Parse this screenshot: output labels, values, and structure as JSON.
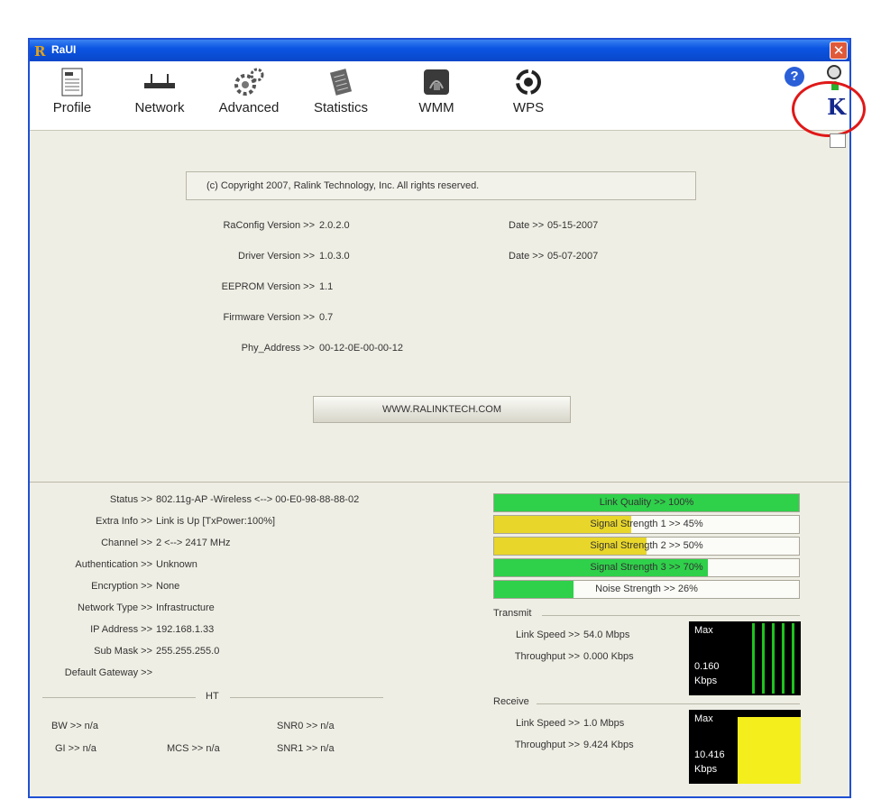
{
  "window": {
    "title": "RaUI",
    "close_glyph": "✕"
  },
  "toolbar": [
    {
      "label": "Profile",
      "icon": "profile-icon"
    },
    {
      "label": "Network",
      "icon": "network-icon"
    },
    {
      "label": "Advanced",
      "icon": "advanced-icon"
    },
    {
      "label": "Statistics",
      "icon": "statistics-icon"
    },
    {
      "label": "WMM",
      "icon": "wmm-icon"
    },
    {
      "label": "WPS",
      "icon": "wps-icon"
    }
  ],
  "about": {
    "copyright": "(c) Copyright 2007, Ralink Technology, Inc.  All rights reserved.",
    "raconfig_label": "RaConfig Version >>",
    "raconfig_value": "2.0.2.0",
    "raconfig_date_label": "Date >>",
    "raconfig_date": "05-15-2007",
    "driver_label": "Driver Version >>",
    "driver_value": "1.0.3.0",
    "driver_date_label": "Date >>",
    "driver_date": "05-07-2007",
    "eeprom_label": "EEPROM Version >>",
    "eeprom_value": "1.1",
    "firmware_label": "Firmware Version >>",
    "firmware_value": "0.7",
    "phy_label": "Phy_Address >>",
    "phy_value": "00-12-0E-00-00-12",
    "website_button": "WWW.RALINKTECH.COM"
  },
  "status": {
    "rows": [
      {
        "label": "Status >>",
        "value": "802.11g-AP -Wireless  <--> 00-E0-98-88-88-02"
      },
      {
        "label": "Extra Info >>",
        "value": "Link is Up [TxPower:100%]"
      },
      {
        "label": "Channel >>",
        "value": "2 <--> 2417 MHz"
      },
      {
        "label": "Authentication >>",
        "value": "Unknown"
      },
      {
        "label": "Encryption >>",
        "value": "None"
      },
      {
        "label": "Network Type >>",
        "value": "Infrastructure"
      },
      {
        "label": "IP Address >>",
        "value": "192.168.1.33"
      },
      {
        "label": "Sub Mask >>",
        "value": "255.255.255.0"
      },
      {
        "label": "Default Gateway >>",
        "value": ""
      }
    ],
    "ht": {
      "title": "HT",
      "bw": "BW >> n/a",
      "gi": "GI >> n/a",
      "mcs": "MCS >> n/a",
      "snr0": "SNR0 >> n/a",
      "snr1": "SNR1 >> n/a"
    }
  },
  "signal_bars": [
    {
      "label": "Link Quality >> 100%",
      "level": 1.0,
      "color": "#2fd04a"
    },
    {
      "label": "Signal Strength 1 >> 45%",
      "level": 0.45,
      "color": "#e8d62a"
    },
    {
      "label": "Signal Strength 2 >> 50%",
      "level": 0.5,
      "color": "#e8d62a"
    },
    {
      "label": "Signal Strength 3 >> 70%",
      "level": 0.7,
      "color": "#2fd04a"
    },
    {
      "label": "Noise Strength >> 26%",
      "level": 0.26,
      "color": "#2fd04a"
    }
  ],
  "transmit": {
    "title": "Transmit",
    "link_speed_label": "Link Speed >>",
    "link_speed": "54.0 Mbps",
    "throughput_label": "Throughput >>",
    "throughput": "0.000 Kbps",
    "graph_max": "Max",
    "graph_value": "0.160",
    "graph_unit": "Kbps",
    "graph_color": "#1fc21f"
  },
  "receive": {
    "title": "Receive",
    "link_speed_label": "Link Speed >>",
    "link_speed": "1.0 Mbps",
    "throughput_label": "Throughput >>",
    "throughput": "9.424 Kbps",
    "graph_max": "Max",
    "graph_value": "10.416",
    "graph_unit": "Kbps",
    "graph_color": "#f3ee1c"
  }
}
